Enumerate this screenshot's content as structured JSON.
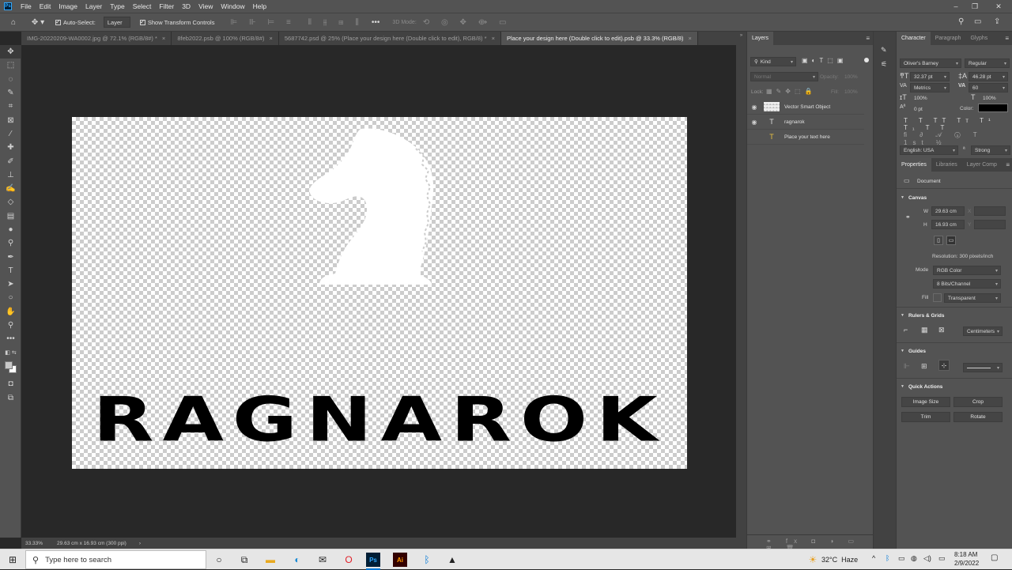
{
  "app": {
    "logo": "Ps"
  },
  "menu": [
    "File",
    "Edit",
    "Image",
    "Layer",
    "Type",
    "Select",
    "Filter",
    "3D",
    "View",
    "Window",
    "Help"
  ],
  "window_controls": [
    "–",
    "❐",
    "✕"
  ],
  "options_bar": {
    "auto_select_label": "Auto-Select:",
    "auto_select_target": "Layer",
    "show_transform_label": "Show Transform Controls",
    "mode_3d_label": "3D Mode:"
  },
  "tabs": [
    {
      "label": "IMG-20220209-WA0002.jpg @ 72.1% (RGB/8#) *",
      "close": "×"
    },
    {
      "label": "8feb2022.psb @ 100% (RGB/8#)",
      "close": "×"
    },
    {
      "label": "5687742.psd @ 25% (Place your design here (Double click to edit), RGB/8) *",
      "close": "×"
    },
    {
      "label": "Place your design here (Double click to edit).psb @ 33.3% (RGB/8)",
      "close": "×"
    }
  ],
  "canvas": {
    "artwork_text": "RAGNAROK"
  },
  "status": {
    "zoom": "33.33%",
    "doc_info": "29.63 cm x 16.93 cm (300 ppi)",
    "arrow": "›"
  },
  "layers": {
    "tab": "Layers",
    "filter_kind": "Kind",
    "blend_mode": "Normal",
    "opacity_label": "Opacity:",
    "opacity_value": "100%",
    "lock_label": "Lock:",
    "fill_label": "Fill:",
    "fill_value": "100%",
    "items": [
      {
        "name": "Vector Smart Object",
        "visible": true
      },
      {
        "name": "ragnarok",
        "visible": true
      },
      {
        "name": "Place your text here",
        "visible": false
      }
    ]
  },
  "character": {
    "tabs": [
      "Character",
      "Paragraph",
      "Glyphs"
    ],
    "font_family": "Oliver's Barney",
    "font_style": "Regular",
    "font_size": "32.37 pt",
    "leading": "46.28 pt",
    "kerning": "Metrics",
    "tracking": "60",
    "vertical_scale": "100%",
    "horizontal_scale": "100%",
    "baseline_shift": "0 pt",
    "color_label": "Color:",
    "language": "English: USA",
    "antialias": "Strong"
  },
  "properties": {
    "tabs": [
      "Properties",
      "Libraries",
      "Layer Comp"
    ],
    "document_label": "Document",
    "canvas_section": "Canvas",
    "w_label": "W",
    "w_value": "29.63 cm",
    "h_label": "H",
    "h_value": "16.93 cm",
    "x_label": "X",
    "y_label": "Y",
    "resolution": "Resolution: 300 pixels/inch",
    "mode_label": "Mode",
    "mode_value": "RGB Color",
    "bit_depth": "8 Bits/Channel",
    "fill_label": "Fill",
    "fill_value": "Transparent",
    "rulers_section": "Rulers & Grids",
    "units": "Centimeters",
    "guides_section": "Guides",
    "quick_actions_section": "Quick Actions",
    "quick_actions": [
      "Image Size",
      "Crop",
      "Trim",
      "Rotate"
    ]
  },
  "taskbar": {
    "search_placeholder": "Type here to search",
    "weather": "32°C  Haze",
    "time": "8:18 AM",
    "date": "2/9/2022"
  }
}
